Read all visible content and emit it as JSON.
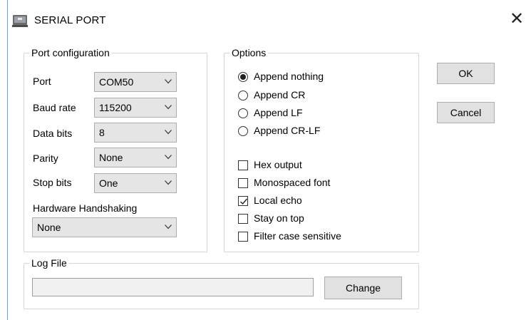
{
  "window": {
    "title": "SERIAL PORT",
    "close_glyph": "✕",
    "title_icon": "serial-port-icon"
  },
  "port_configuration": {
    "legend": "Port configuration",
    "fields": [
      {
        "label": "Port",
        "value": "COM50"
      },
      {
        "label": "Baud rate",
        "value": "115200"
      },
      {
        "label": "Data bits",
        "value": "8"
      },
      {
        "label": "Parity",
        "value": "None"
      },
      {
        "label": "Stop bits",
        "value": "One"
      }
    ],
    "handshaking": {
      "label": "Hardware Handshaking",
      "value": "None"
    }
  },
  "options": {
    "legend": "Options",
    "radios": [
      {
        "label": "Append nothing",
        "checked": true
      },
      {
        "label": "Append CR",
        "checked": false
      },
      {
        "label": "Append LF",
        "checked": false
      },
      {
        "label": "Append CR-LF",
        "checked": false
      }
    ],
    "checkboxes": [
      {
        "label": "Hex output",
        "checked": false
      },
      {
        "label": "Monospaced font",
        "checked": false
      },
      {
        "label": "Local echo",
        "checked": true
      },
      {
        "label": "Stay on top",
        "checked": false
      },
      {
        "label": "Filter case sensitive",
        "checked": false
      }
    ]
  },
  "buttons": {
    "ok": "OK",
    "cancel": "Cancel"
  },
  "log_file": {
    "legend": "Log File",
    "path": "",
    "change_button": "Change"
  }
}
